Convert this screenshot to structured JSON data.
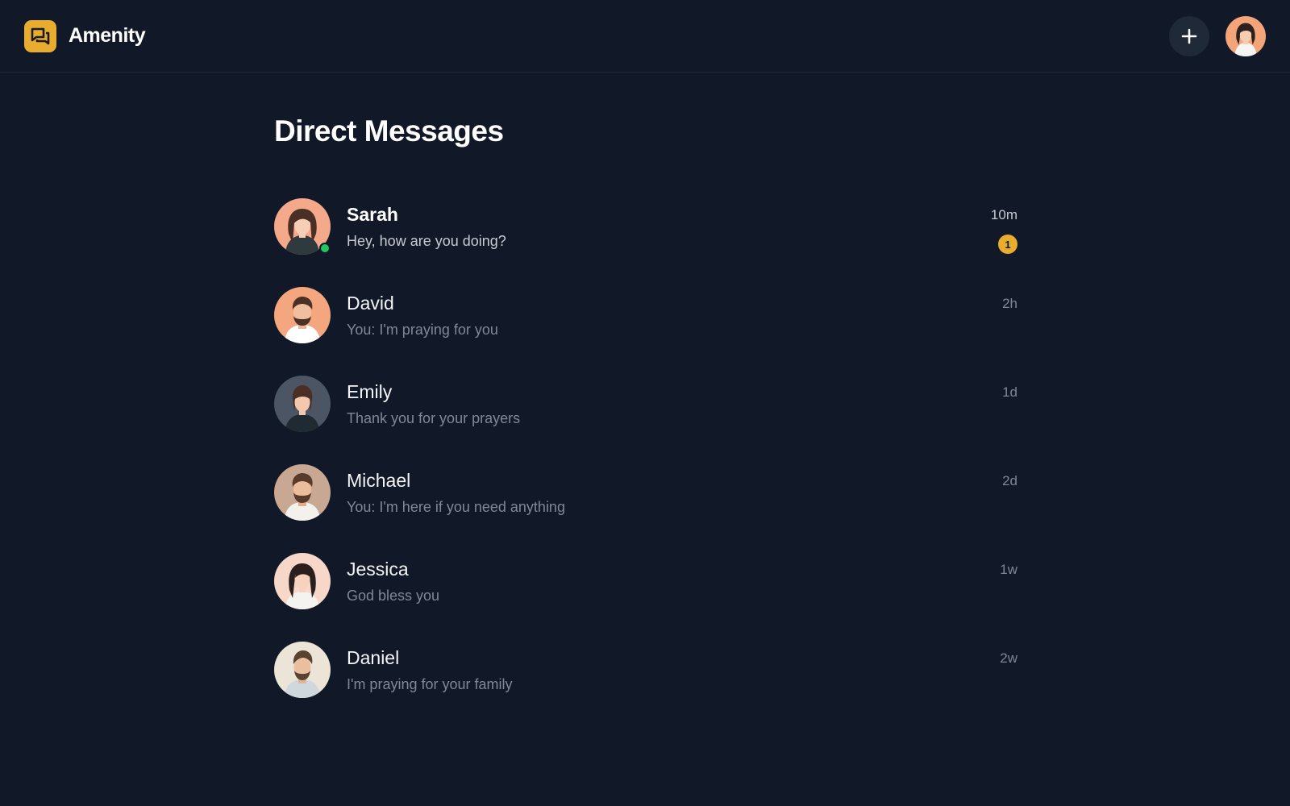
{
  "app": {
    "name": "Amenity",
    "accent": "#e8ad2e",
    "background": "#111827"
  },
  "header": {
    "logo_icon": "chat-bubbles-icon",
    "new_message_icon": "plus-icon",
    "user_avatar": "user-avatar-woman"
  },
  "page": {
    "title": "Direct Messages"
  },
  "conversations": [
    {
      "name": "Sarah",
      "preview": "Hey, how are you doing?",
      "time": "10m",
      "unread_count": "1",
      "online": true,
      "unread": true
    },
    {
      "name": "David",
      "preview": "You: I'm praying for you",
      "time": "2h",
      "unread_count": "",
      "online": false,
      "unread": false
    },
    {
      "name": "Emily",
      "preview": "Thank you for your prayers",
      "time": "1d",
      "unread_count": "",
      "online": false,
      "unread": false
    },
    {
      "name": "Michael",
      "preview": "You: I'm here if you need anything",
      "time": "2d",
      "unread_count": "",
      "online": false,
      "unread": false
    },
    {
      "name": "Jessica",
      "preview": "God bless you",
      "time": "1w",
      "unread_count": "",
      "online": false,
      "unread": false
    },
    {
      "name": "Daniel",
      "preview": "I'm praying for your family",
      "time": "2w",
      "unread_count": "",
      "online": false,
      "unread": false
    }
  ]
}
